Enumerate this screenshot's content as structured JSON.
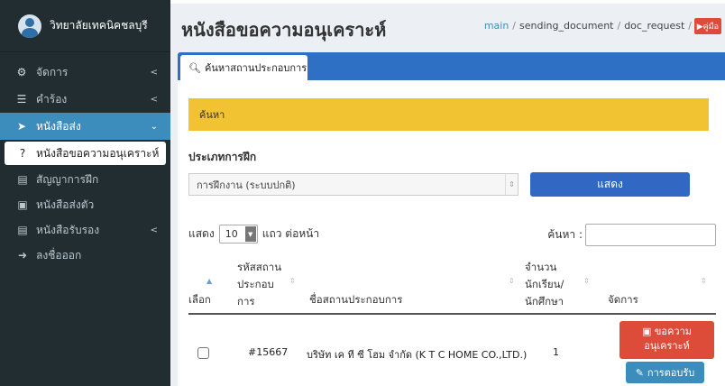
{
  "sidebar": {
    "brand_name": "วิทยาลัยเทคนิคชลบุรี",
    "menu": [
      {
        "label": "จัดการ",
        "icon": "cogs-icon"
      },
      {
        "label": "คำร้อง",
        "icon": "list-icon"
      },
      {
        "label": "หนังสือส่ง",
        "icon": "paper-plane-icon"
      }
    ],
    "submenu": [
      {
        "label": "หนังสือขอความอนุเคราะห์",
        "icon": "question-circle-icon"
      },
      {
        "label": "สัญญาการฝึก",
        "icon": "file-icon"
      },
      {
        "label": "หนังสือส่งตัว",
        "icon": "car-icon"
      },
      {
        "label": "หนังสือรับรอง",
        "icon": "file-icon"
      }
    ],
    "logout": "ลงชื่อออก"
  },
  "header": {
    "title": "หนังสือขอความอนุเคราะห์",
    "breadcrumb": [
      "main",
      "sending_document",
      "doc_request"
    ],
    "manual": "คู่มือ"
  },
  "tab": {
    "label": "ค้นหาสถานประกอบการ"
  },
  "search_panel": {
    "heading": "ค้นหา",
    "training_type_label": "ประเภทการฝึก",
    "training_type_value": "การฝึกงาน (ระบบปกติ)",
    "show_button": "แสดง"
  },
  "table": {
    "length_prefix": "แสดง",
    "length_value": "10",
    "length_suffix": "แถว ต่อหน้า",
    "search_label": "ค้นหา :",
    "columns": {
      "select": "เลือก",
      "code": [
        "รหัสสถาน",
        "ประกอบ",
        "การ"
      ],
      "name": "ชื่อสถานประกอบการ",
      "count": [
        "จำนวน",
        "นักเรียน/",
        "นักศึกษา"
      ],
      "actions": "จัดการ"
    },
    "rows": [
      {
        "code": "#15667",
        "name": "บริษัท เค ที ซี โฮม จำกัด (K T C HOME CO.,LTD.)",
        "count": "1",
        "request_button": [
          "ขอความ",
          "อนุเคราะห์"
        ],
        "accept_button": "การตอบรับ"
      }
    ]
  },
  "colors": {
    "sidebar": "#222d32",
    "active": "#3c8dbc",
    "panel_head": "#f1c232",
    "danger": "#dd4b39",
    "primary": "#3267c3"
  }
}
